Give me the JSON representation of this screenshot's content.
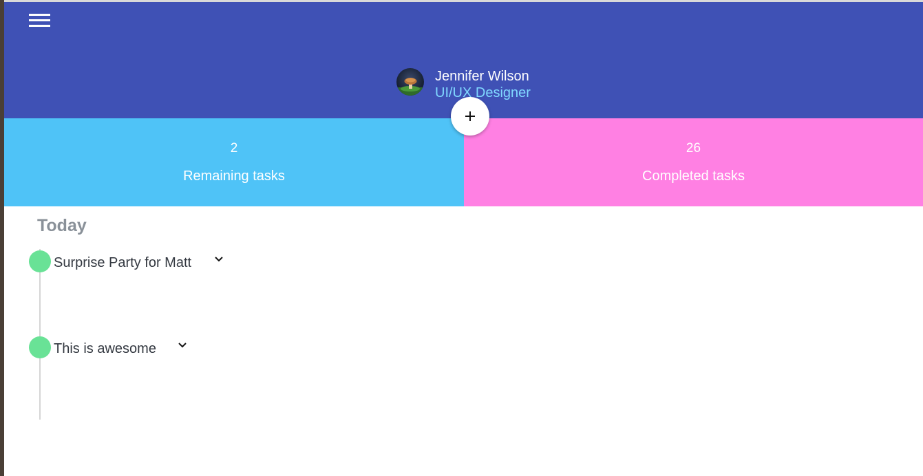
{
  "header": {
    "menu_icon": "hamburger-menu-icon",
    "background_color": "#3f51b5"
  },
  "profile": {
    "name": "Jennifer Wilson",
    "role": "UI/UX Designer",
    "role_color": "#80d8ff"
  },
  "fab": {
    "icon": "plus-icon"
  },
  "stats": {
    "remaining": {
      "value": "2",
      "label": "Remaining tasks",
      "color": "#4fc3f7"
    },
    "completed": {
      "value": "26",
      "label": "Completed tasks",
      "color": "#ff80e3"
    }
  },
  "timeline": {
    "section_title": "Today",
    "dot_color": "#69e296",
    "tasks": [
      {
        "title": "Surprise Party for Matt",
        "icon": "chevron-down-icon"
      },
      {
        "title": "This is awesome",
        "icon": "chevron-down-icon"
      }
    ]
  }
}
